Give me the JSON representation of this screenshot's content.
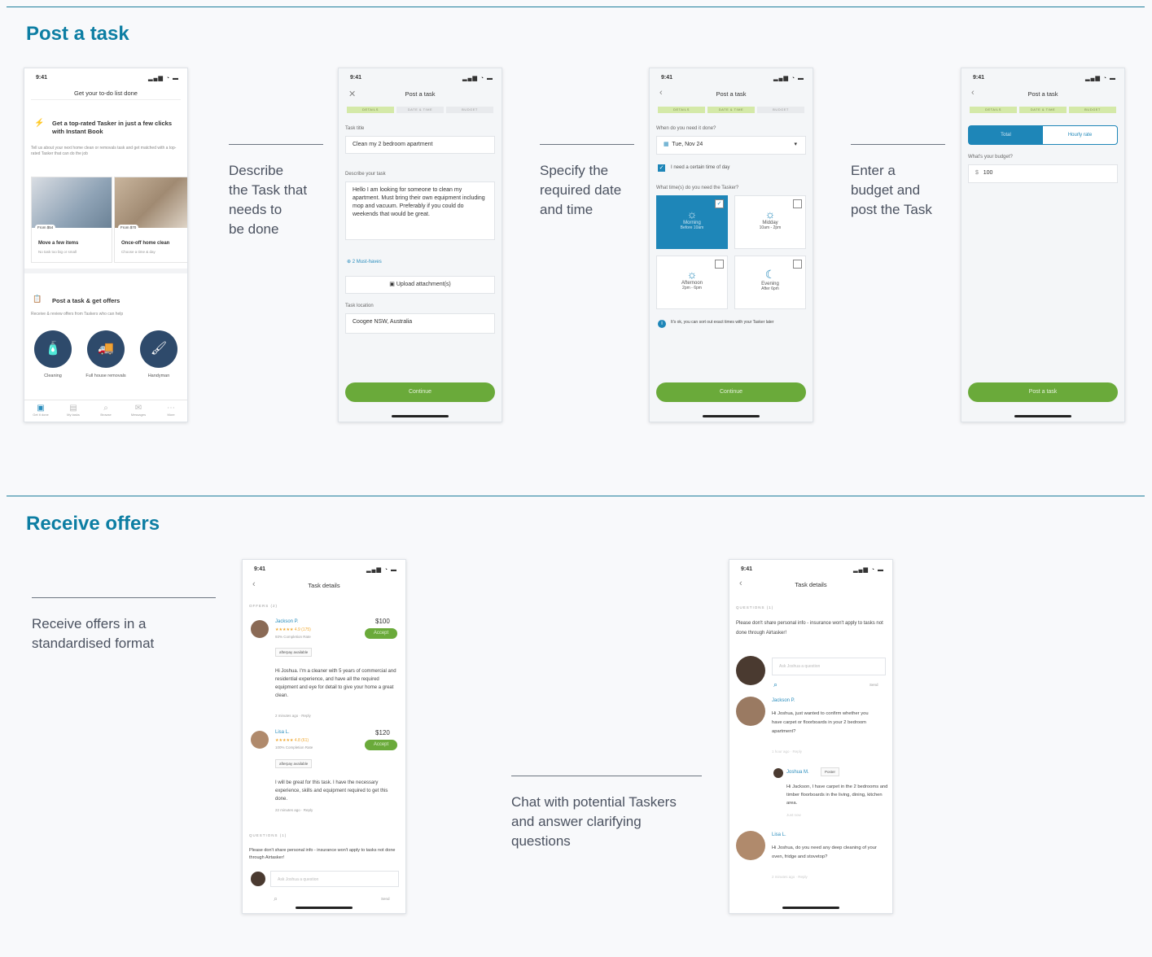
{
  "sections": {
    "post_title": "Post a task",
    "receive_title": "Receive offers"
  },
  "descriptions": {
    "describe": [
      "Describe",
      "the Task that",
      "needs to",
      "be done"
    ],
    "date": [
      "Specify the",
      "required date",
      "and time"
    ],
    "budget": [
      "Enter a",
      "budget and",
      "post the Task"
    ],
    "offers": [
      "Receive offers in a",
      "standardised format"
    ],
    "chat": [
      "Chat with potential Taskers",
      "and answer clarifying",
      "questions"
    ]
  },
  "status": {
    "time": "9:41",
    "signal": "▂▄▆ ◔ ▬"
  },
  "phone1": {
    "header": "Get your to-do list done",
    "instant_title": "Get a top-rated Tasker in just a few clicks with Instant Book",
    "instant_desc": "Tell us about your next home clean or removals task and get matched with a top-rated Tasker that can do the job",
    "card1_price": "From $54",
    "card1_title": "Move a few items",
    "card1_sub": "No task too big or small",
    "card2_price": "From $70",
    "card2_title": "Once-off home clean",
    "card2_sub": "Choose a time & day",
    "post_title": "Post a task & get offers",
    "post_desc": "Receive & review offers from Taskers who can help",
    "cat1": "Cleaning",
    "cat2": "Full house removals",
    "cat3": "Handyman",
    "tabs": [
      "Get it done",
      "My tasks",
      "Browse",
      "Messages",
      "More"
    ]
  },
  "phone2": {
    "title": "Post a task",
    "steps": [
      "DETAILS",
      "DATE & TIME",
      "BUDGET"
    ],
    "task_title_label": "Task title",
    "task_title": "Clean my 2 bedroom apartment",
    "describe_label": "Describe your task",
    "describe": "Hello I am looking for someone to clean my apartment. Must bring their own equipment including mop and vacuum. Preferably if you could do weekends that would be great.",
    "must_haves": "2 Must-haves",
    "upload": "Upload attachment(s)",
    "location_label": "Task location",
    "location": "Coogee NSW, Australia",
    "cta": "Continue"
  },
  "phone3": {
    "title": "Post a task",
    "when_label": "When do you need it done?",
    "date": "Tue, Nov 24",
    "certain_time": "I need a certain time of day",
    "times_label": "What time(s) do you need the Tasker?",
    "morning": "Morning",
    "morning_sub": "Before 10am",
    "midday": "Midday",
    "midday_sub": "10am - 2pm",
    "afternoon": "Afternoon",
    "afternoon_sub": "2pm - 6pm",
    "evening": "Evening",
    "evening_sub": "After 6pm",
    "note": "It's ok, you can sort out exact times with your Tasker later",
    "cta": "Continue"
  },
  "phone4": {
    "title": "Post a task",
    "total": "Total",
    "hourly": "Hourly rate",
    "budget_label": "What's your budget?",
    "currency": "$",
    "budget": "100",
    "cta": "Post a task"
  },
  "phone5": {
    "title": "Task details",
    "offers_label": "OFFERS (2)",
    "o1_name": "Jackson P.",
    "o1_rating": "★★★★★ 4.9 (175)",
    "o1_rate": "93% Completion Rate",
    "o1_price": "$100",
    "o1_pay": "afterpay available",
    "o1_msg": "Hi Joshua. I'm a cleaner with 5 years of commercial and residential experience, and have all the required equipment and eye for detail to give your home a great clean.",
    "o1_meta": "2 minutes ago · Reply",
    "o2_name": "Lisa L.",
    "o2_rating": "★★★★★ 4.8 (61)",
    "o2_rate": "100% Completion Rate",
    "o2_price": "$120",
    "o2_pay": "afterpay available",
    "o2_msg": "I will be great for this task. I have the necessary experience, skills and equipment required to get this done.",
    "o2_meta": "22 minutes ago · Reply",
    "accept": "Accept",
    "questions_label": "QUESTIONS (1)",
    "questions_note": "Please don't share personal info - insurance won't apply to tasks not done through Airtasker!",
    "ask_placeholder": "Ask Joshua a question",
    "send": "Send"
  },
  "phone6": {
    "title": "Task details",
    "questions_label": "QUESTIONS (1)",
    "note": "Please don't share personal info - insurance won't apply to tasks not done through Airtasker!",
    "input_placeholder": "Ask Joshua a question",
    "send": "Send",
    "q1_name": "Jackson P.",
    "q1_msg": "Hi Joshua, just wanted to confirm whether you have carpet or floorboards in your 2 bedroom apartment?",
    "q1_meta": "1 hour ago · Reply",
    "r_name": "Joshua M.",
    "r_badge": "Poster",
    "r_msg": "Hi Jackson, I have carpet in the 2 bedrooms and timber floorboards in the living, dining, kitchen area.",
    "r_meta": "Just now",
    "q2_name": "Lisa L.",
    "q2_msg": "Hi Joshua, do you need any deep cleaning of your oven, fridge and stovetop?",
    "q2_meta": "2 minutes ago · Reply"
  }
}
